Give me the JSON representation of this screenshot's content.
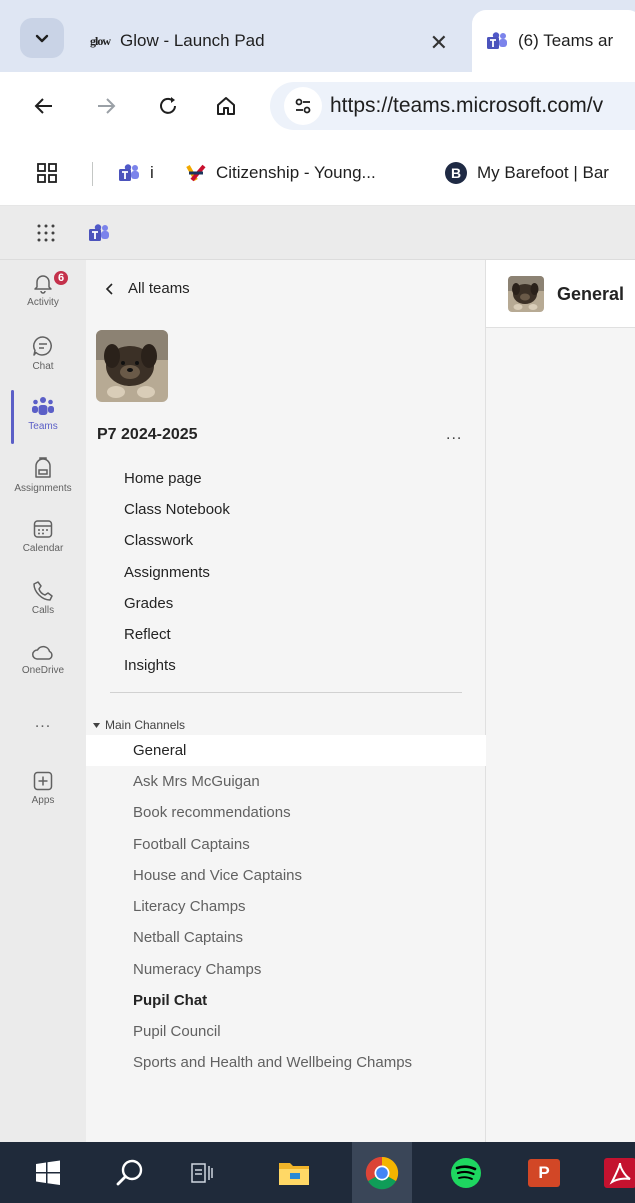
{
  "browser": {
    "tabs": [
      {
        "title": "Glow - Launch Pad",
        "favicon_text": "glow"
      },
      {
        "title": "(6) Teams ar"
      }
    ],
    "url": "https://teams.microsoft.com/v",
    "bookmarks": [
      {
        "label": "i"
      },
      {
        "label": "Citizenship - Young..."
      },
      {
        "label": "My Barefoot | Bar",
        "icon_letter": "B"
      }
    ]
  },
  "rail": {
    "items": [
      {
        "label": "Activity",
        "badge": "6"
      },
      {
        "label": "Chat"
      },
      {
        "label": "Teams"
      },
      {
        "label": "Assignments"
      },
      {
        "label": "Calendar"
      },
      {
        "label": "Calls"
      },
      {
        "label": "OneDrive"
      },
      {
        "label": "..."
      },
      {
        "label": "Apps"
      }
    ],
    "active_color": "#5b5fc7"
  },
  "team_panel": {
    "back_label": "All teams",
    "team_name": "P7 2024-2025",
    "more": "...",
    "tabs": [
      "Home page",
      "Class Notebook",
      "Classwork",
      "Assignments",
      "Grades",
      "Reflect",
      "Insights"
    ],
    "section_title": "Main Channels",
    "channels": [
      "General",
      "Ask Mrs McGuigan",
      "Book recommendations",
      "Football Captains",
      "House and Vice Captains",
      "Literacy Champs",
      "Netball Captains",
      "Numeracy Champs",
      "Pupil Chat",
      "Pupil Council",
      "Sports and Health and Wellbeing Champs"
    ],
    "selected_channel": "General",
    "bold_channel": "Pupil Chat"
  },
  "main": {
    "channel_title": "General"
  },
  "taskbar": {
    "icons": [
      "windows-start",
      "search",
      "task-view",
      "file-explorer",
      "chrome",
      "spotify",
      "powerpoint",
      "acrobat"
    ],
    "powerpoint_letter": "P"
  }
}
